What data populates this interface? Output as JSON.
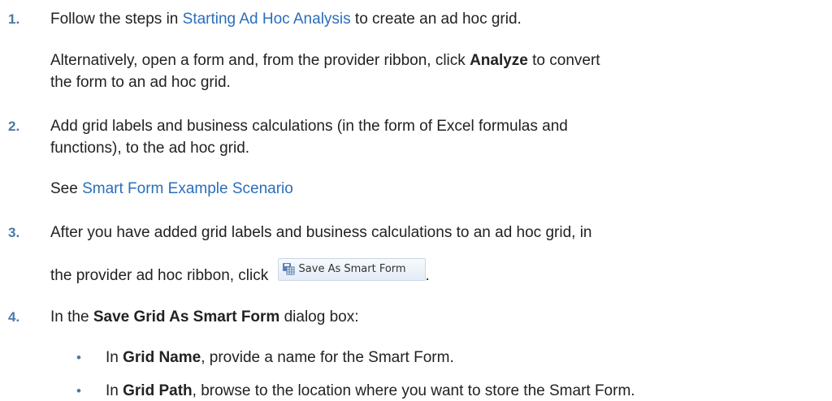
{
  "steps": [
    {
      "number": "1.",
      "line1_pre": "Follow the steps in ",
      "line1_link": "Starting Ad Hoc Analysis",
      "line1_post": " to create an ad hoc grid.",
      "alt_line1_pre": "Alternatively, open a form and, from the provider ribbon, click ",
      "alt_line1_bold": "Analyze",
      "alt_line1_post": " to convert",
      "alt_line2": "the form to an ad hoc grid."
    },
    {
      "number": "2.",
      "line1": "Add grid labels and business calculations (in the form of Excel formulas and",
      "line2": "functions), to the ad hoc grid.",
      "see_pre": "See ",
      "see_link": "Smart Form Example Scenario"
    },
    {
      "number": "3.",
      "line1": "After you have added grid labels and business calculations to an ad hoc grid, in",
      "line2_pre": "the provider ad hoc ribbon, click ",
      "line2_post": ".",
      "button_label": "Save As Smart Form",
      "button_icon": "save-smart-form-icon"
    },
    {
      "number": "4.",
      "line1_pre": "In the ",
      "line1_bold": "Save Grid As Smart Form",
      "line1_post": " dialog box:",
      "bullets": [
        {
          "symbol": "•",
          "pre": "In ",
          "bold": "Grid Name",
          "post": ", provide a name for the Smart Form."
        },
        {
          "symbol": "•",
          "pre": "In ",
          "bold": "Grid Path",
          "post": ", browse to the location where you want to store the Smart Form."
        }
      ]
    }
  ],
  "colors": {
    "accent": "#4a78a8",
    "link": "#2a6ebb",
    "text": "#222222"
  }
}
